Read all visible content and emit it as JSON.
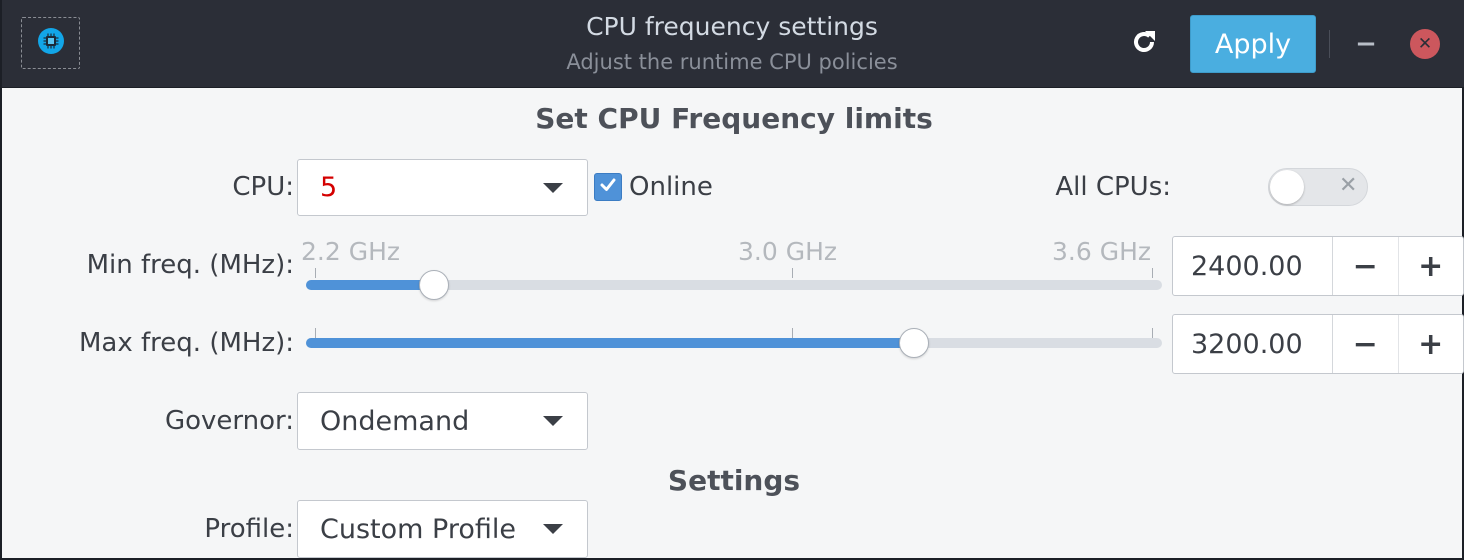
{
  "header": {
    "title": "CPU frequency settings",
    "subtitle": "Adjust the runtime CPU policies",
    "apply_label": "Apply",
    "app_icon": "cpu-chip-icon",
    "refresh_icon": "refresh-icon",
    "minimize_icon": "minimize-icon",
    "close_icon": "close-icon",
    "minimize_glyph": "−",
    "close_glyph": "✕"
  },
  "limits": {
    "section_title": "Set CPU Frequency limits",
    "cpu_label": "CPU:",
    "cpu_value": "5",
    "online_label": "Online",
    "online_checked": true,
    "all_cpus_label": "All CPUs:",
    "all_cpus_enabled": false,
    "all_cpus_off_glyph": "✕",
    "min_label": "Min freq. (MHz):",
    "max_label": "Max freq. (MHz):",
    "tick_labels": [
      "2.2 GHz",
      "3.0 GHz",
      "3.6 GHz"
    ],
    "min_value": "2400.00",
    "max_value": "3200.00",
    "min_fraction": 0.15,
    "max_fraction": 0.71,
    "minus_glyph": "−",
    "plus_glyph": "+",
    "governor_label": "Governor:",
    "governor_value": "Ondemand"
  },
  "settings": {
    "section_title": "Settings",
    "profile_label": "Profile:",
    "profile_value": "Custom Profile"
  },
  "colors": {
    "header_bg": "#2b2e37",
    "accent": "#4aaee0",
    "slider_fill": "#4f92d8",
    "cpu_value": "#d40000",
    "close": "#cc575d"
  }
}
